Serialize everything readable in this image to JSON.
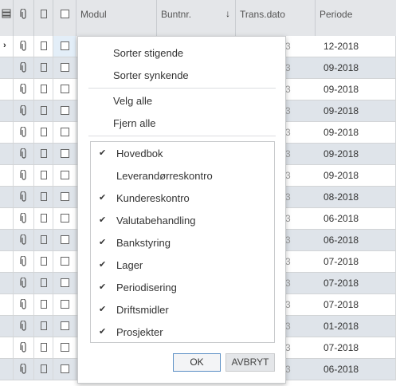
{
  "header": {
    "columns": [
      "Modul",
      "Buntnr.",
      "Trans.dato",
      "Periode"
    ],
    "sort_indicator": "↓",
    "icons": [
      "list-icon",
      "paperclip-icon",
      "document-icon",
      "checkbox-icon"
    ]
  },
  "rows": [
    {
      "periode": "12-2018",
      "partial": "3",
      "current": true
    },
    {
      "periode": "09-2018",
      "partial": "3"
    },
    {
      "periode": "09-2018",
      "partial": "3"
    },
    {
      "periode": "09-2018",
      "partial": "3"
    },
    {
      "periode": "09-2018",
      "partial": "3"
    },
    {
      "periode": "09-2018",
      "partial": "3"
    },
    {
      "periode": "09-2018",
      "partial": "3"
    },
    {
      "periode": "08-2018",
      "partial": "3"
    },
    {
      "periode": "06-2018",
      "partial": "3"
    },
    {
      "periode": "06-2018",
      "partial": "3"
    },
    {
      "periode": "07-2018",
      "partial": "3"
    },
    {
      "periode": "07-2018",
      "partial": "3"
    },
    {
      "periode": "07-2018",
      "partial": "3"
    },
    {
      "periode": "01-2018",
      "partial": "3"
    },
    {
      "periode": "07-2018",
      "partial": "3"
    },
    {
      "periode": "06-2018",
      "partial": "3"
    }
  ],
  "popup": {
    "sort_asc": "Sorter stigende",
    "sort_desc": "Sorter synkende",
    "select_all": "Velg alle",
    "clear_all": "Fjern alle",
    "items": [
      {
        "label": "Hovedbok",
        "checked": true
      },
      {
        "label": "Leverandørreskontro",
        "checked": false
      },
      {
        "label": "Kundereskontro",
        "checked": true
      },
      {
        "label": "Valutabehandling",
        "checked": true
      },
      {
        "label": "Bankstyring",
        "checked": true
      },
      {
        "label": "Lager",
        "checked": true
      },
      {
        "label": "Periodisering",
        "checked": true
      },
      {
        "label": "Driftsmidler",
        "checked": true
      },
      {
        "label": "Prosjekter",
        "checked": true
      }
    ],
    "ok_label": "OK",
    "cancel_label": "AVBRYT"
  },
  "colors": {
    "header_bg": "#e4e6e9",
    "row_alt": "#dfe4ea",
    "row_selected": "#e3eef8",
    "ok_border": "#5a8ec4"
  }
}
